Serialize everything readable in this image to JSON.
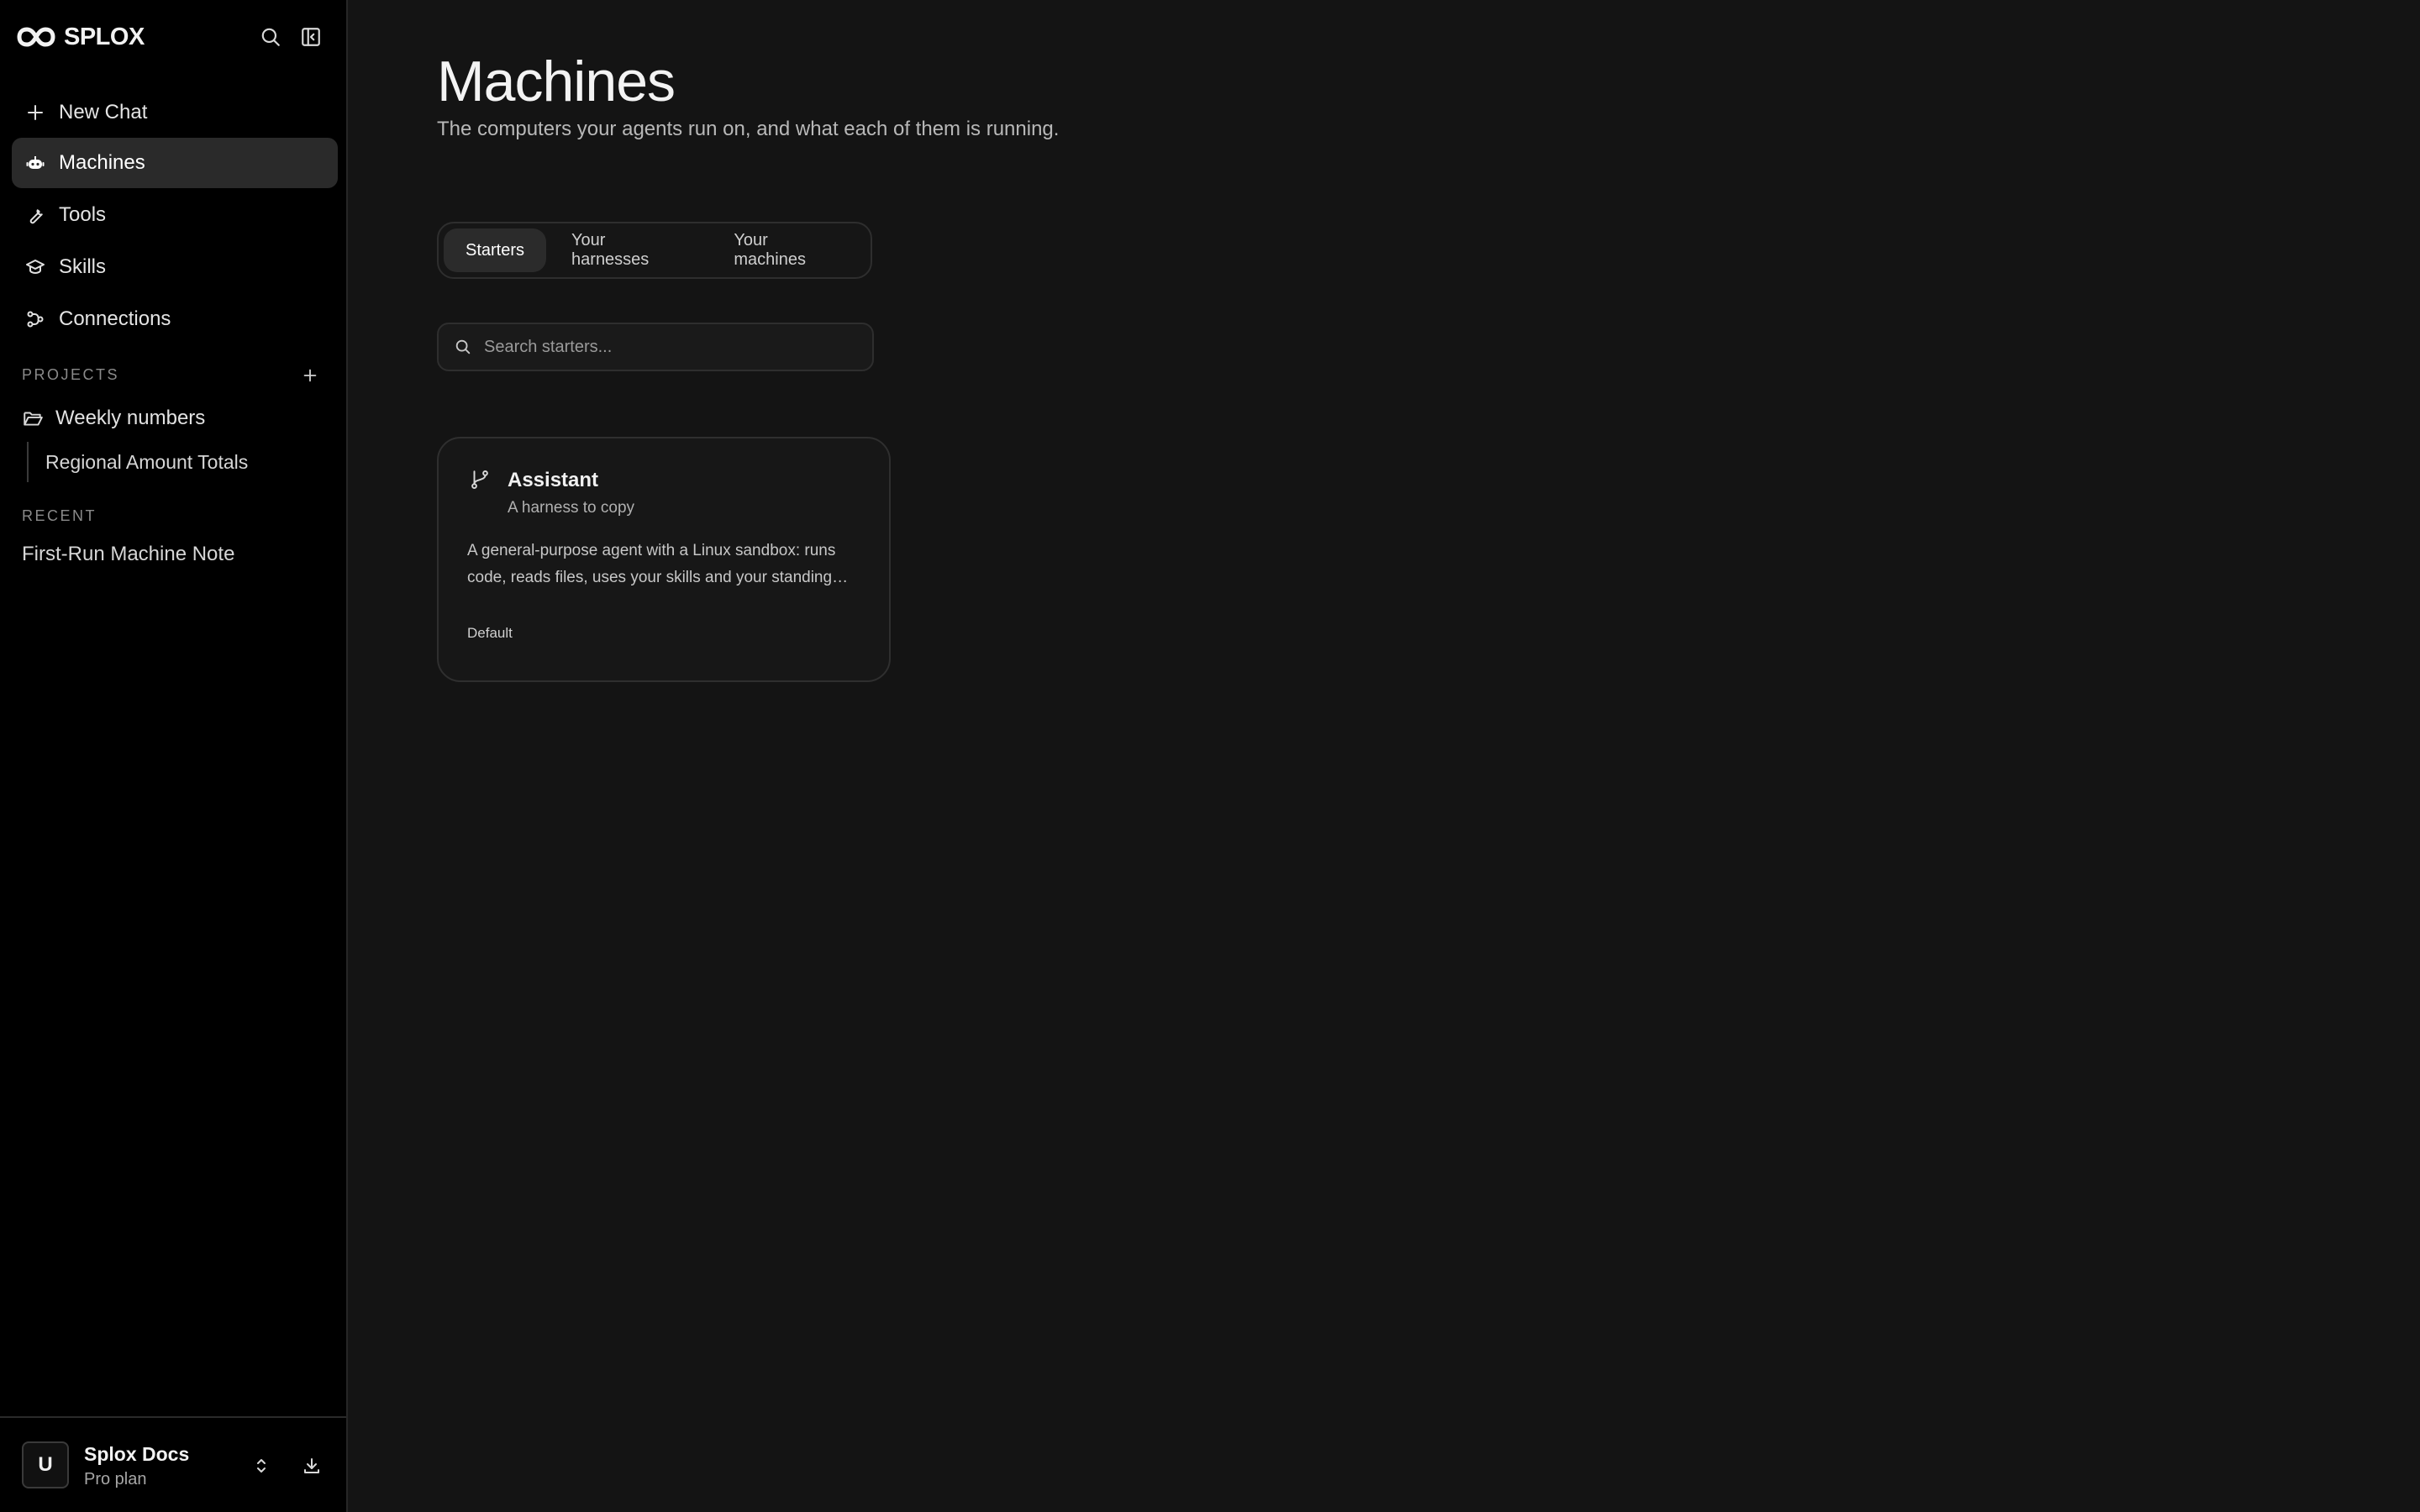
{
  "app": {
    "brand": "SPLOX"
  },
  "sidebar": {
    "nav": [
      {
        "label": "New Chat",
        "icon": "plus-icon"
      },
      {
        "label": "Machines",
        "icon": "robot-icon",
        "active": true
      },
      {
        "label": "Tools",
        "icon": "wrench-icon"
      },
      {
        "label": "Skills",
        "icon": "graduation-cap-icon"
      },
      {
        "label": "Connections",
        "icon": "connections-icon"
      }
    ],
    "projects_label": "PROJECTS",
    "projects": [
      {
        "label": "Weekly numbers",
        "icon": "folder-open-icon",
        "children": [
          "Regional Amount Totals"
        ]
      }
    ],
    "recent_label": "RECENT",
    "recent": [
      "First-Run Machine Note"
    ],
    "account": {
      "initial": "U",
      "name": "Splox Docs",
      "plan": "Pro plan"
    }
  },
  "main": {
    "title": "Machines",
    "subtitle": "The computers your agents run on, and what each of them is running.",
    "tabs": [
      {
        "label": "Starters",
        "active": true
      },
      {
        "label": "Your harnesses"
      },
      {
        "label": "Your machines"
      }
    ],
    "search": {
      "placeholder": "Search starters..."
    },
    "cards": [
      {
        "title": "Assistant",
        "subtitle": "A harness to copy",
        "description": "A general-purpose agent with a Linux sandbox: runs code, reads files, uses your skills and your standing instructions.",
        "badge": "Default",
        "icon": "git-branch-icon"
      }
    ]
  },
  "colors": {
    "background": "#141414",
    "sidebar": "#000000",
    "active_item": "#2a2a2a",
    "border": "#2e2e2e",
    "text": "#ececec",
    "muted": "#8a8a8a"
  }
}
